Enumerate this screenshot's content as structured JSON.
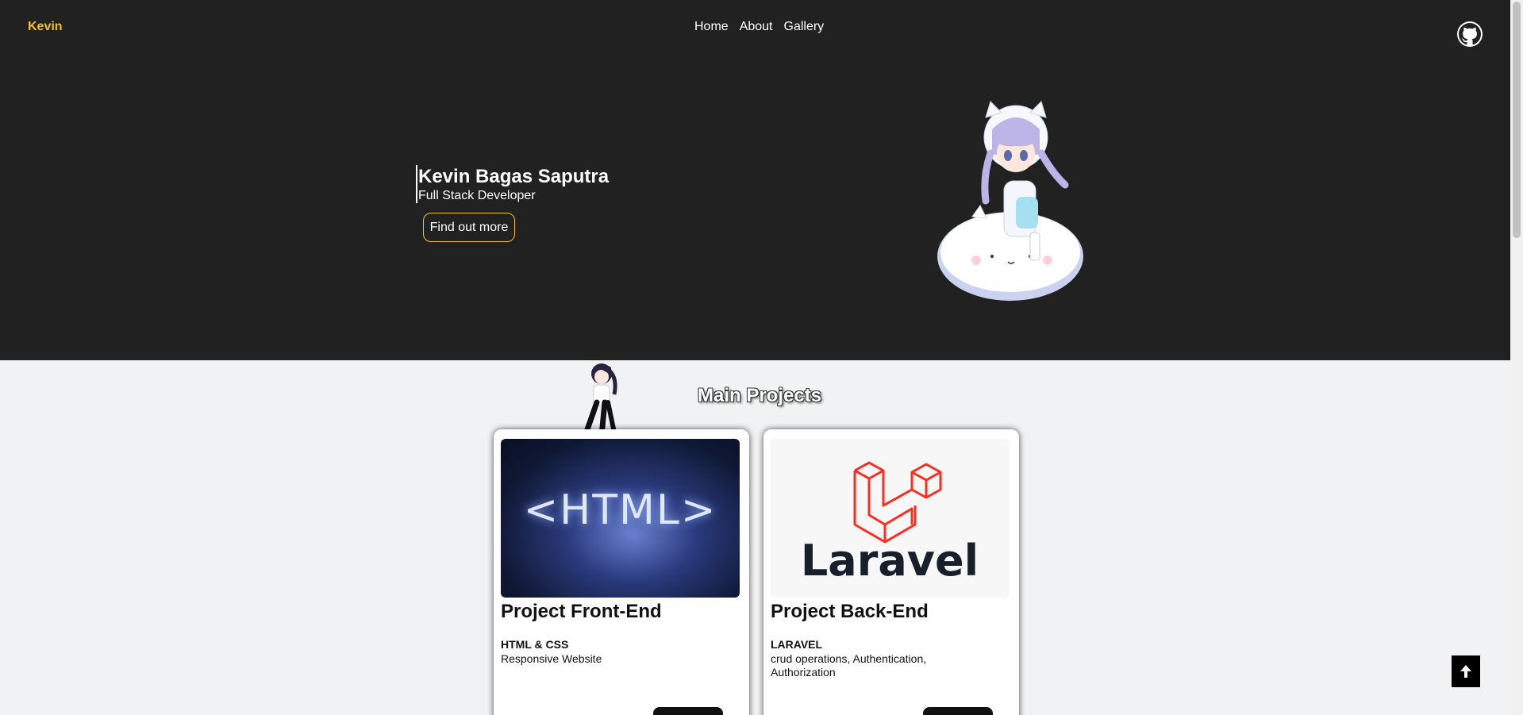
{
  "header": {
    "brand": "Kevin",
    "nav": [
      "Home",
      "About",
      "Gallery"
    ],
    "github_icon": "github-icon"
  },
  "hero": {
    "name": "Kevin Bagas Saputra",
    "role": "Full Stack Developer",
    "cta": "Find out more"
  },
  "projects": {
    "title": "Main Projects",
    "cards": [
      {
        "thumb_text": "<HTML>",
        "title": "Project Front-End",
        "tech": "HTML & CSS",
        "desc": "Responsive Website"
      },
      {
        "thumb_text": "Laravel",
        "title": "Project Back-End",
        "tech": "LARAVEL",
        "desc": "crud operations, Authentication, Authorization"
      }
    ]
  },
  "colors": {
    "accent": "#f2c21a",
    "hero_bg": "#212122",
    "page_bg": "#f1f2f4",
    "laravel_red": "#ff2d20"
  }
}
